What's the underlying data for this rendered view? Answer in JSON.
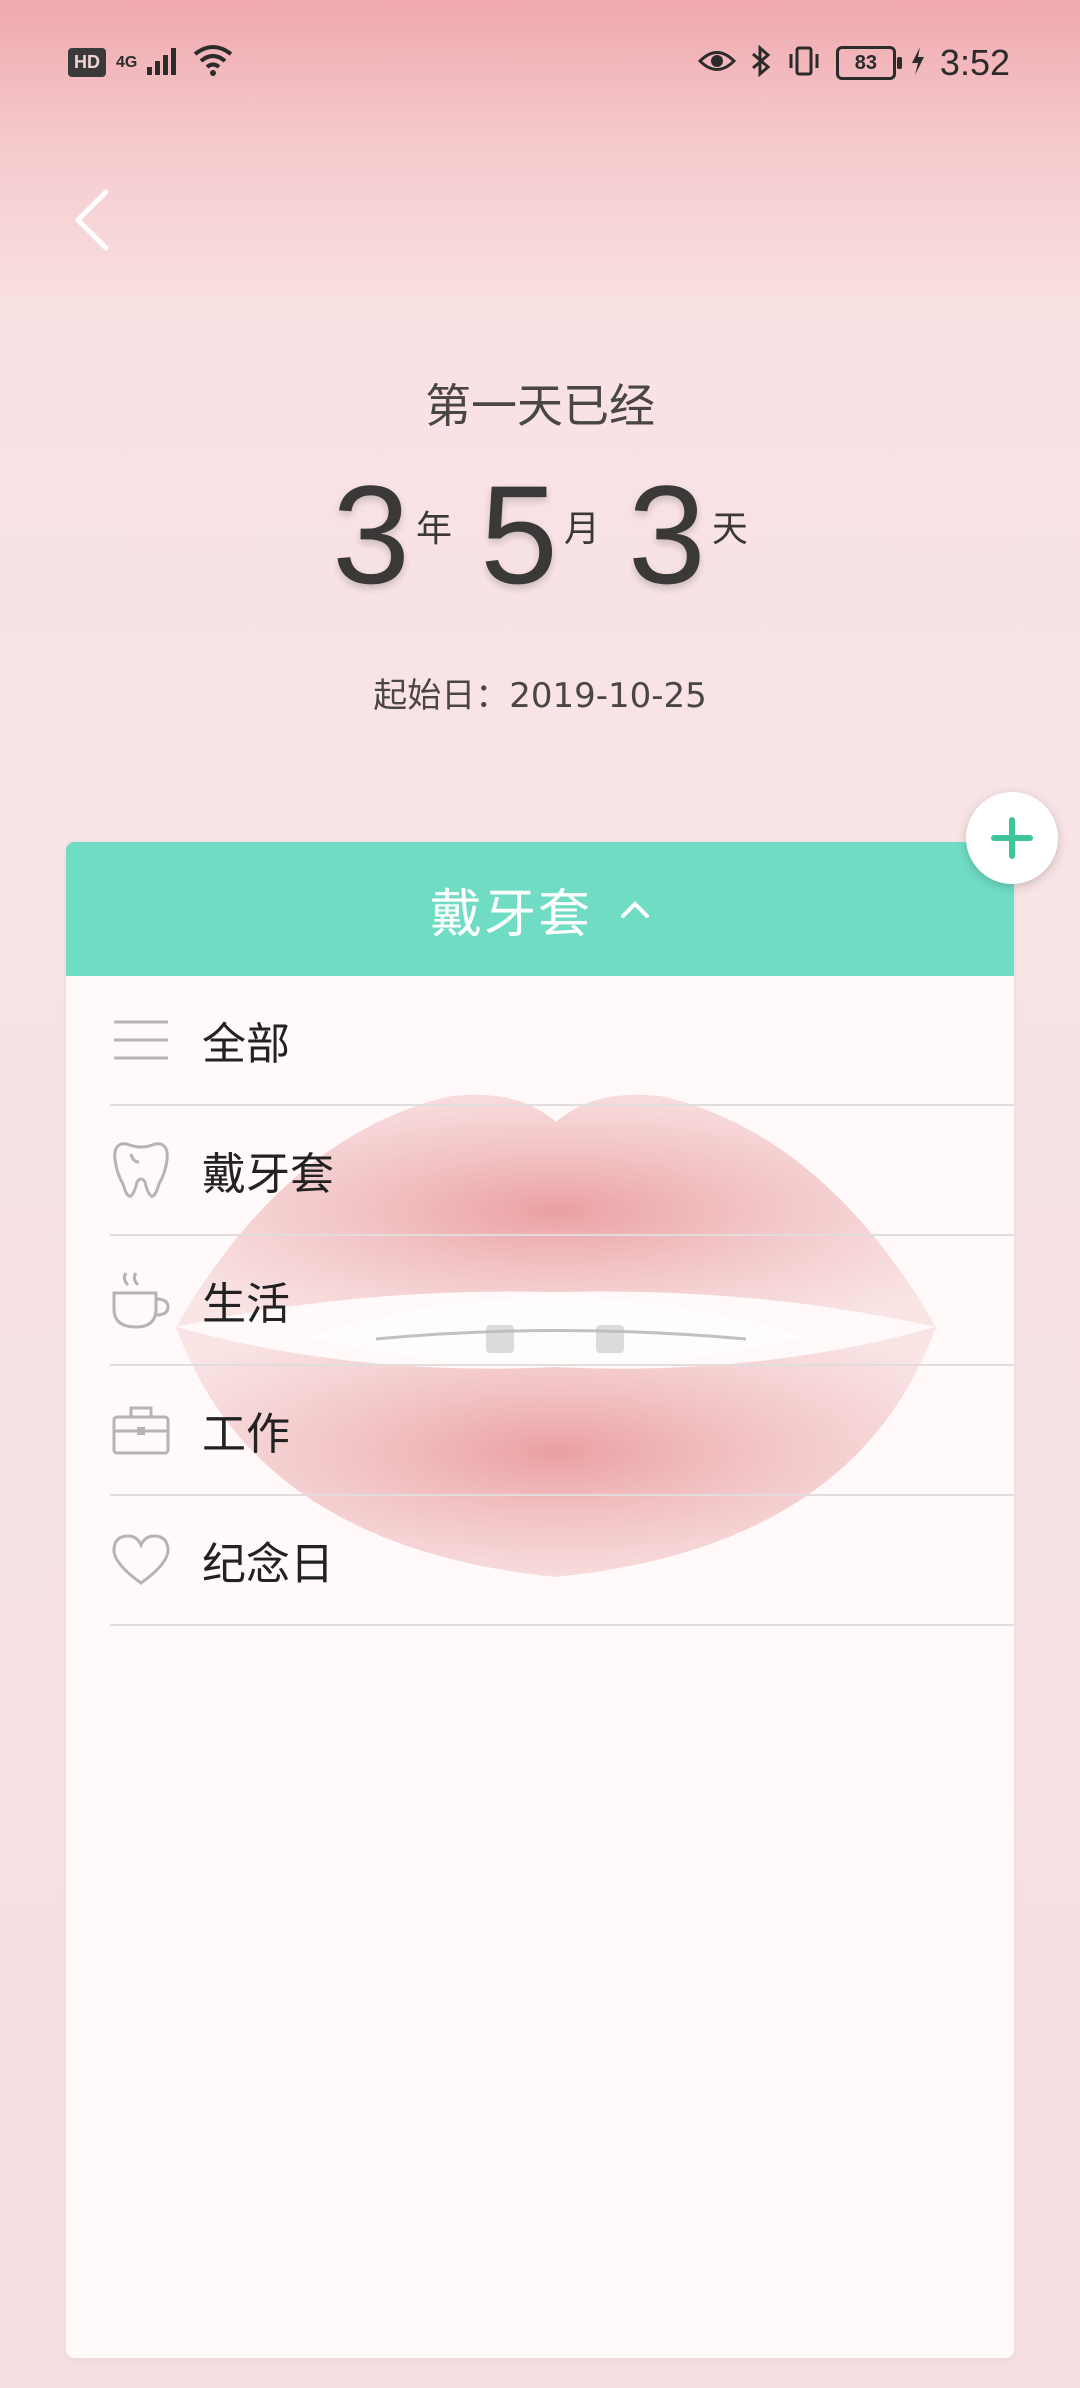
{
  "status_bar": {
    "hd": "HD",
    "network": "4G",
    "battery": "83",
    "time": "3:52"
  },
  "header": {
    "subtitle": "第一天已经",
    "duration": {
      "years": "3",
      "year_unit": "年",
      "months": "5",
      "month_unit": "月",
      "days": "3",
      "day_unit": "天"
    },
    "start_date": "起始日：2019-10-25"
  },
  "card": {
    "title": "戴牙套",
    "accent_color": "#70dcc3",
    "items": [
      {
        "label": "全部",
        "icon": "list-icon"
      },
      {
        "label": "戴牙套",
        "icon": "tooth-icon"
      },
      {
        "label": "生活",
        "icon": "coffee-cup-icon"
      },
      {
        "label": "工作",
        "icon": "briefcase-icon"
      },
      {
        "label": "纪念日",
        "icon": "heart-icon"
      }
    ]
  },
  "fab": {
    "icon": "plus-icon"
  }
}
